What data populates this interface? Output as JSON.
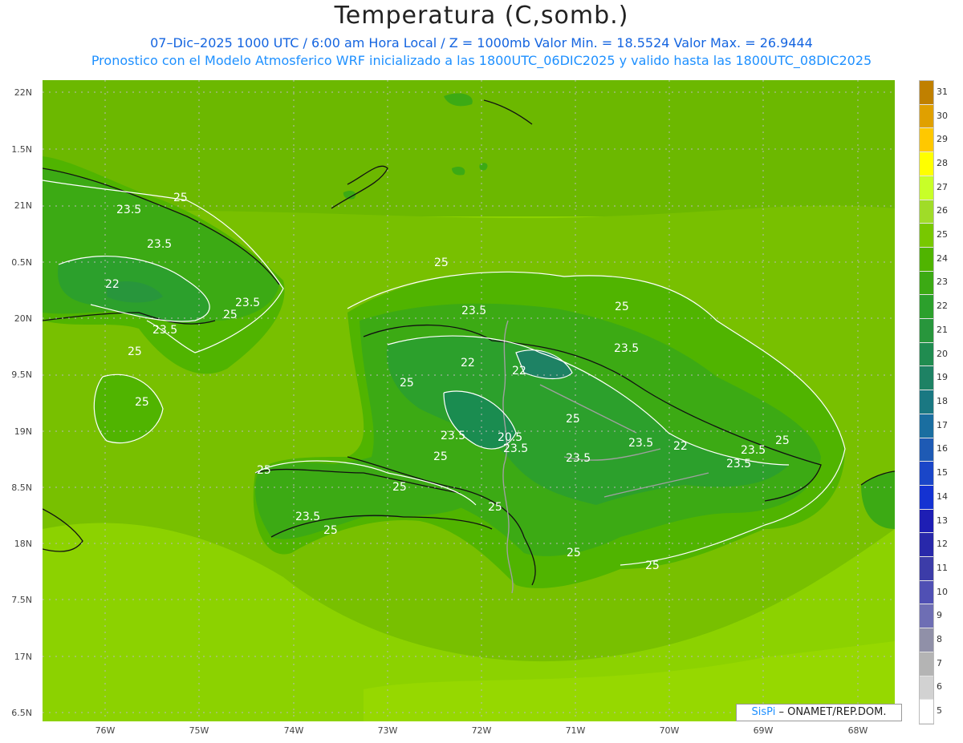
{
  "title": "Temperatura (C,somb.)",
  "subtitle1": "07–Dic–2025  1000 UTC / 6:00 am Hora Local / Z = 1000mb    Valor Min. = 18.5524  Valor Max. = 26.9444",
  "subtitle2": "Pronostico con el Modelo Atmosferico WRF inicializado a las 1800UTC_06DIC2025 y valido hasta las  1800UTC_08DIC2025",
  "y_axis_labels": [
    "22N",
    "1.5N",
    "21N",
    "0.5N",
    "20N",
    "9.5N",
    "19N",
    "8.5N",
    "18N",
    "7.5N",
    "17N",
    "6.5N"
  ],
  "x_axis_labels": [
    "76W",
    "75W",
    "74W",
    "73W",
    "72W",
    "71W",
    "70W",
    "69W",
    "68W"
  ],
  "colorbar": {
    "labels": [
      "31",
      "30",
      "29",
      "28",
      "27",
      "26",
      "25",
      "24",
      "23",
      "22",
      "21",
      "20",
      "19",
      "18",
      "17",
      "16",
      "15",
      "14",
      "13",
      "12",
      "11",
      "10",
      "9",
      "8",
      "7",
      "6",
      "5"
    ],
    "colors": [
      "#c08000",
      "#e0a000",
      "#ffc800",
      "#ffff00",
      "#c8ff28",
      "#a0dc28",
      "#78c800",
      "#50b400",
      "#3caa14",
      "#2ca02c",
      "#28963c",
      "#208c50",
      "#1e8264",
      "#1a7882",
      "#1a6ea0",
      "#1e5ab4",
      "#1a46c8",
      "#1432d2",
      "#1e1eb4",
      "#2828aa",
      "#3c3ca8",
      "#5050b4",
      "#6e6eb4",
      "#9090a8",
      "#b4b4b4",
      "#d2d2d2",
      "#ffffff"
    ]
  },
  "contour_labels": [
    "25",
    "23.5",
    "23.5",
    "22",
    "23.5",
    "25",
    "25",
    "25",
    "25",
    "23.5",
    "25",
    "23.5",
    "22",
    "25",
    "22",
    "23.5",
    "25",
    "20.5",
    "23.5",
    "23.5",
    "23.5",
    "22",
    "23.5",
    "23.5",
    "25",
    "25",
    "25",
    "25",
    "23.5",
    "25",
    "25",
    "25",
    "23.5",
    "25"
  ],
  "colors": {
    "sea_light": "#8cd200",
    "sea_mid": "#78c000",
    "land_warm": "#64b400",
    "land_mid": "#3caa14",
    "land_cool": "#2ca02c",
    "land_cold": "#1a8c50"
  },
  "credit": {
    "brand": "SisPi",
    "rest": " – ONAMET/REP.DOM."
  }
}
